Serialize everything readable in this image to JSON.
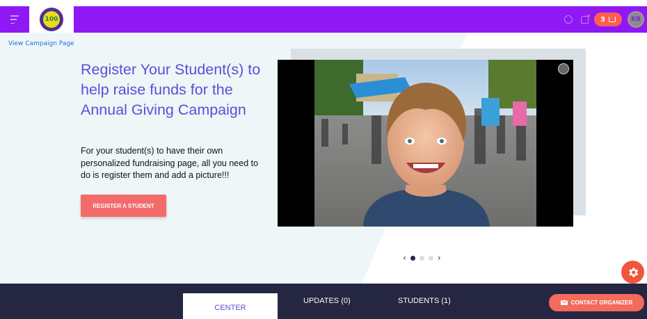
{
  "topbar": {
    "logo_text": "100",
    "cart_count": "3",
    "avatar_initials": "KB"
  },
  "hero": {
    "view_link": "View Campaign Page",
    "headline": "Register Your Student(s) to help raise funds for the Annual Giving Campaign",
    "description": "For your student(s) to have their own personalized fundraising page, all you need to do is register them and add a picture!!!",
    "register_button": "REGISTER A STUDENT"
  },
  "carousel": {
    "prev": "‹",
    "next": "›"
  },
  "tabs": {
    "center": "CENTER",
    "updates": "UPDATES (0)",
    "students": "STUDENTS (1)"
  },
  "contact_button": "CONTACT ORGANIZER",
  "colors": {
    "topbar": "#8f18f5",
    "accent_text": "#5a4fd6",
    "button_red": "#f26b6b",
    "bottombar": "#242642"
  }
}
